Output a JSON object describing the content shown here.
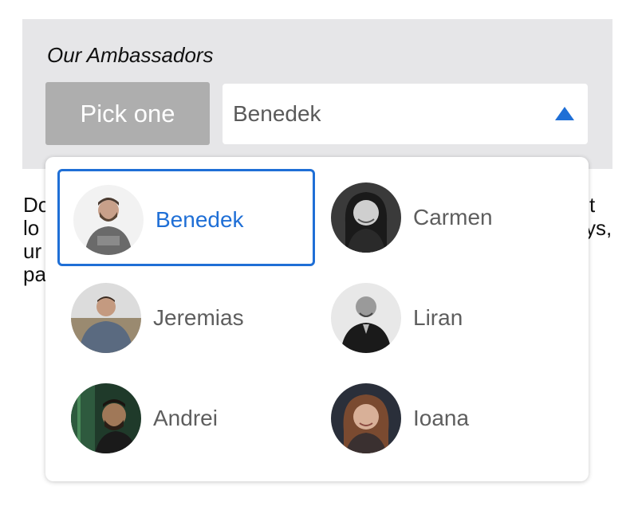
{
  "panel": {
    "title": "Our Ambassadors",
    "pick_label": "Pick one",
    "selected_value": "Benedek",
    "arrow_icon": "triangle-up-icon",
    "accent_color": "#1f6fd6"
  },
  "body_text": {
    "lines": [
      {
        "start": "Do",
        "end": "t"
      },
      {
        "start": "lo",
        "end": "ys,"
      },
      {
        "start": "ur",
        "end": ""
      },
      {
        "start": "pa",
        "end": ""
      }
    ]
  },
  "dropdown": {
    "selected_index": 0,
    "options": [
      {
        "name": "Benedek",
        "avatar": "avatar-photo"
      },
      {
        "name": "Carmen",
        "avatar": "avatar-photo"
      },
      {
        "name": "Jeremias",
        "avatar": "avatar-photo"
      },
      {
        "name": "Liran",
        "avatar": "avatar-photo"
      },
      {
        "name": "Andrei",
        "avatar": "avatar-photo"
      },
      {
        "name": "Ioana",
        "avatar": "avatar-photo"
      }
    ]
  }
}
